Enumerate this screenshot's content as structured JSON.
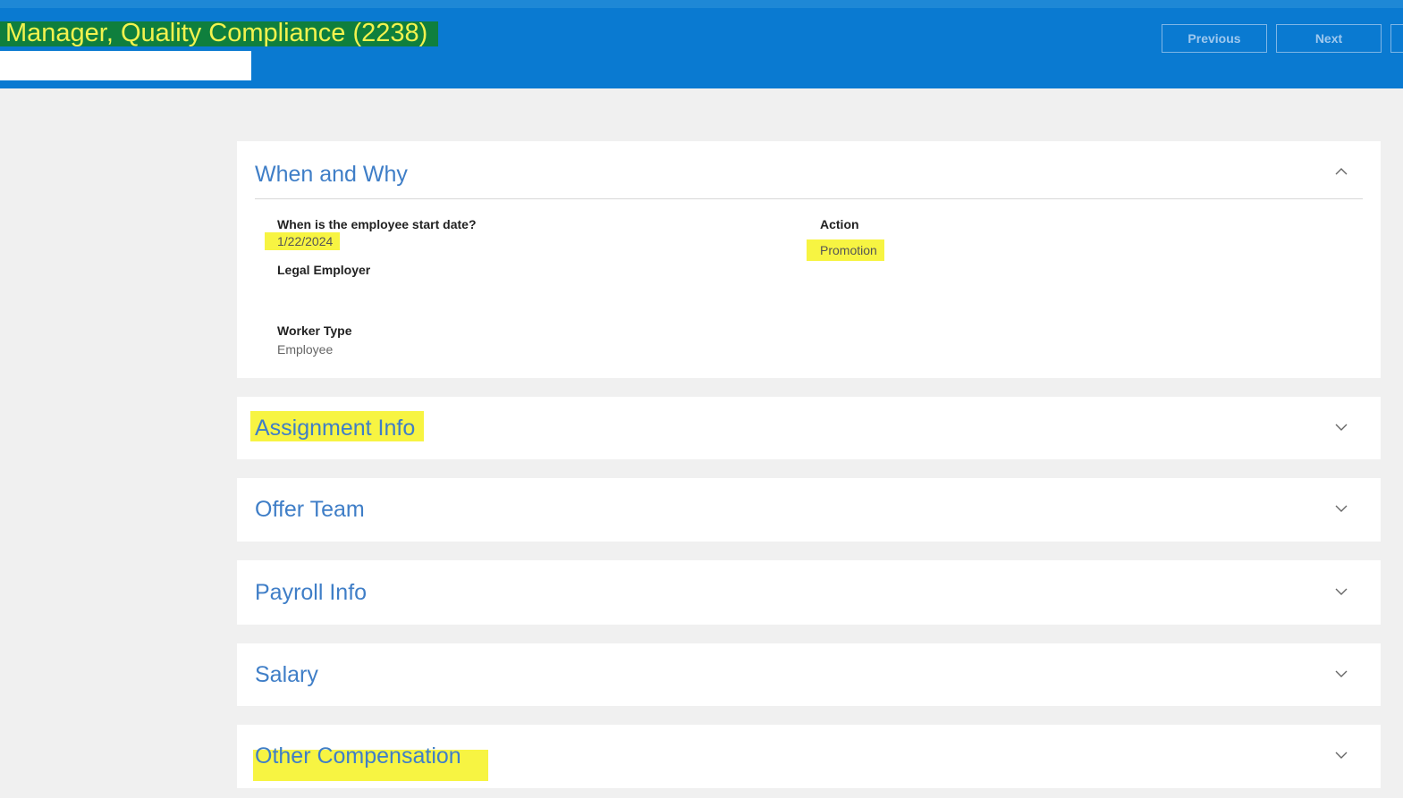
{
  "header": {
    "title": "Manager, Quality Compliance (2238)",
    "previous_label": "Previous",
    "next_label": "Next"
  },
  "sections": [
    {
      "title": "When and Why",
      "expanded": true,
      "fields": {
        "start_date_label": "When is the employee start date?",
        "start_date_value": "1/22/2024",
        "legal_employer_label": "Legal Employer",
        "worker_type_label": "Worker Type",
        "worker_type_value": "Employee",
        "action_label": "Action",
        "action_value": "Promotion"
      }
    },
    {
      "title": "Assignment Info",
      "expanded": false
    },
    {
      "title": "Offer Team",
      "expanded": false
    },
    {
      "title": "Payroll Info",
      "expanded": false
    },
    {
      "title": "Salary",
      "expanded": false
    },
    {
      "title": "Other Compensation",
      "expanded": false
    }
  ],
  "icons": {
    "collapse": "chevron-up-icon",
    "expand": "chevron-down-icon"
  },
  "colors": {
    "header_bg": "#0a7ad1",
    "section_title": "#3f7ec7",
    "highlight": "#f7f442",
    "title_highlight_bg": "#0f7f3d"
  }
}
